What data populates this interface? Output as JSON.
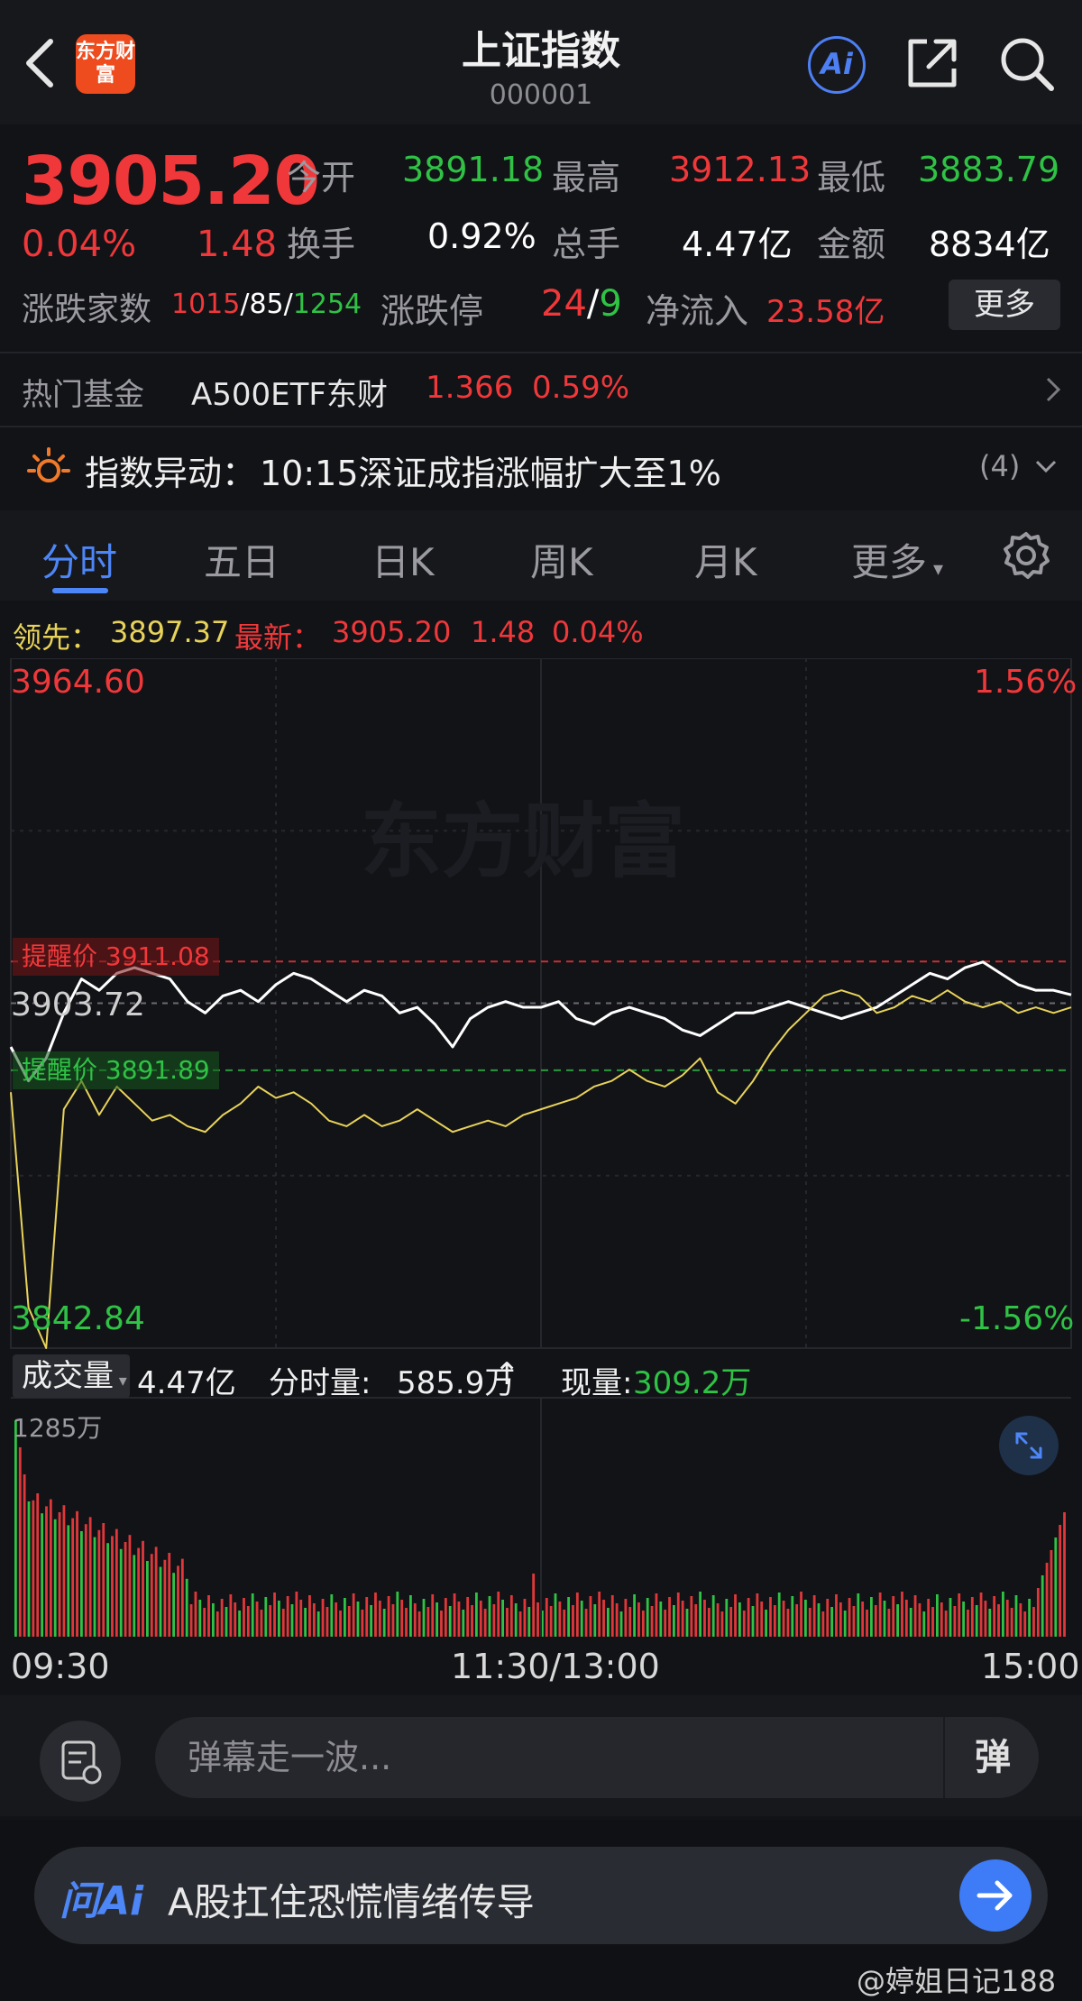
{
  "header": {
    "logo_text": "东方财富",
    "title": "上证指数",
    "code": "000001",
    "ai_label": "Ai",
    "icons": [
      "back-arrow-icon",
      "share-icon",
      "search-icon"
    ]
  },
  "quote": {
    "price": "3905.20",
    "change_pct": "0.04%",
    "change": "1.48",
    "open_label": "今开",
    "open": "3891.18",
    "high_label": "最高",
    "high": "3912.13",
    "low_label": "最低",
    "low": "3883.79",
    "turnover_label": "换手",
    "turnover": "0.92%",
    "volume_label": "总手",
    "volume": "4.47亿",
    "amount_label": "金额",
    "amount": "8834亿",
    "breadth_label": "涨跌家数",
    "up_count": "1015",
    "flat_count": "85",
    "down_count": "1254",
    "limit_label": "涨跌停",
    "limit_up": "24",
    "limit_down": "9",
    "inflow_label": "净流入",
    "inflow": "23.58亿",
    "more_label": "更多"
  },
  "fund": {
    "label": "热门基金",
    "name": "A500ETF东财",
    "price": "1.366",
    "pct": "0.59%"
  },
  "alert": {
    "label": "指数异动：",
    "text": "10:15深证成指涨幅扩大至1%",
    "count": "(4)"
  },
  "tabs": [
    {
      "label": "分时",
      "active": true
    },
    {
      "label": "五日",
      "active": false
    },
    {
      "label": "日K",
      "active": false
    },
    {
      "label": "周K",
      "active": false
    },
    {
      "label": "月K",
      "active": false
    },
    {
      "label": "更多",
      "active": false
    }
  ],
  "lead": {
    "lead_label": "领先：",
    "lead_value": "3897.37",
    "latest_label": "最新：",
    "latest_value": "3905.20",
    "latest_change": "1.48",
    "latest_pct": "0.04%"
  },
  "chart_data": {
    "type": "line",
    "watermark": "东方财富",
    "y_max": "3964.60",
    "y_min": "3842.84",
    "pct_max": "1.56%",
    "pct_min": "-1.56%",
    "prev_close": "3903.72",
    "ylim": [
      3842.84,
      3964.6
    ],
    "reminder_high_label": "提醒价",
    "reminder_high": "3911.08",
    "reminder_low_label": "提醒价",
    "reminder_low": "3891.89",
    "x_labels": [
      "09:30",
      "11:30/13:00",
      "15:00"
    ],
    "series": [
      {
        "name": "最新",
        "color": "#ffffff",
        "x": [
          0,
          4,
          8,
          12,
          16,
          20,
          24,
          28,
          32,
          36,
          40,
          44,
          48,
          52,
          56,
          60,
          64,
          68,
          72,
          76,
          80,
          84,
          88,
          92,
          96,
          100,
          104,
          108,
          112,
          116,
          120,
          124,
          128,
          132,
          136,
          140,
          144,
          148,
          152,
          156,
          160,
          164,
          168,
          172,
          176,
          180,
          184,
          188,
          192,
          196,
          200,
          204,
          208,
          212,
          216,
          220,
          224,
          228,
          232,
          236,
          240
        ],
        "values": [
          3896,
          3890,
          3894,
          3902,
          3908,
          3906,
          3909,
          3910,
          3909,
          3908,
          3904,
          3902,
          3905,
          3906,
          3904,
          3907,
          3909,
          3908,
          3906,
          3904,
          3906,
          3905,
          3902,
          3903,
          3900,
          3896,
          3901,
          3903,
          3904,
          3903,
          3903,
          3904,
          3901,
          3900,
          3902,
          3903,
          3902,
          3901,
          3899,
          3898,
          3900,
          3902,
          3902,
          3903,
          3904,
          3903,
          3902,
          3901,
          3902,
          3903,
          3905,
          3907,
          3909,
          3908,
          3910,
          3911,
          3909,
          3907,
          3906,
          3906,
          3905.2
        ]
      },
      {
        "name": "领先",
        "color": "#e8d35a",
        "x": [
          0,
          4,
          8,
          12,
          16,
          20,
          24,
          28,
          32,
          36,
          40,
          44,
          48,
          52,
          56,
          60,
          64,
          68,
          72,
          76,
          80,
          84,
          88,
          92,
          96,
          100,
          104,
          108,
          112,
          116,
          120,
          124,
          128,
          132,
          136,
          140,
          144,
          148,
          152,
          156,
          160,
          164,
          168,
          172,
          176,
          180,
          184,
          188,
          192,
          196,
          200,
          204,
          208,
          212,
          216,
          220,
          224,
          228,
          232,
          236,
          240
        ],
        "values": [
          3888,
          3850,
          3842.84,
          3885,
          3890,
          3884,
          3889,
          3886,
          3883,
          3884,
          3882,
          3881,
          3884,
          3886,
          3889,
          3887,
          3888,
          3886,
          3883,
          3882,
          3884,
          3882,
          3883,
          3885,
          3883,
          3881,
          3882,
          3883,
          3882,
          3884,
          3885,
          3886,
          3887,
          3889,
          3890,
          3892,
          3890,
          3889,
          3891,
          3894,
          3888,
          3886,
          3890,
          3895,
          3899,
          3902,
          3905,
          3906,
          3905,
          3902,
          3903,
          3905,
          3904,
          3906,
          3904,
          3903,
          3904,
          3902,
          3903,
          3902,
          3903
        ]
      }
    ]
  },
  "volume": {
    "selector_label": "成交量",
    "total": "4.47亿",
    "minute_label": "分时量:",
    "minute_value": "585.9万",
    "current_label": "现量:",
    "current_value": "309.2万",
    "max_label": "1285万"
  },
  "danmu": {
    "placeholder": "弹幕走一波...",
    "toggle_label": "弹"
  },
  "askai": {
    "logo": "问Ai",
    "prompt": "A股扛住恐慌情绪传导"
  },
  "watermark_text": "@婷姐日记188"
}
